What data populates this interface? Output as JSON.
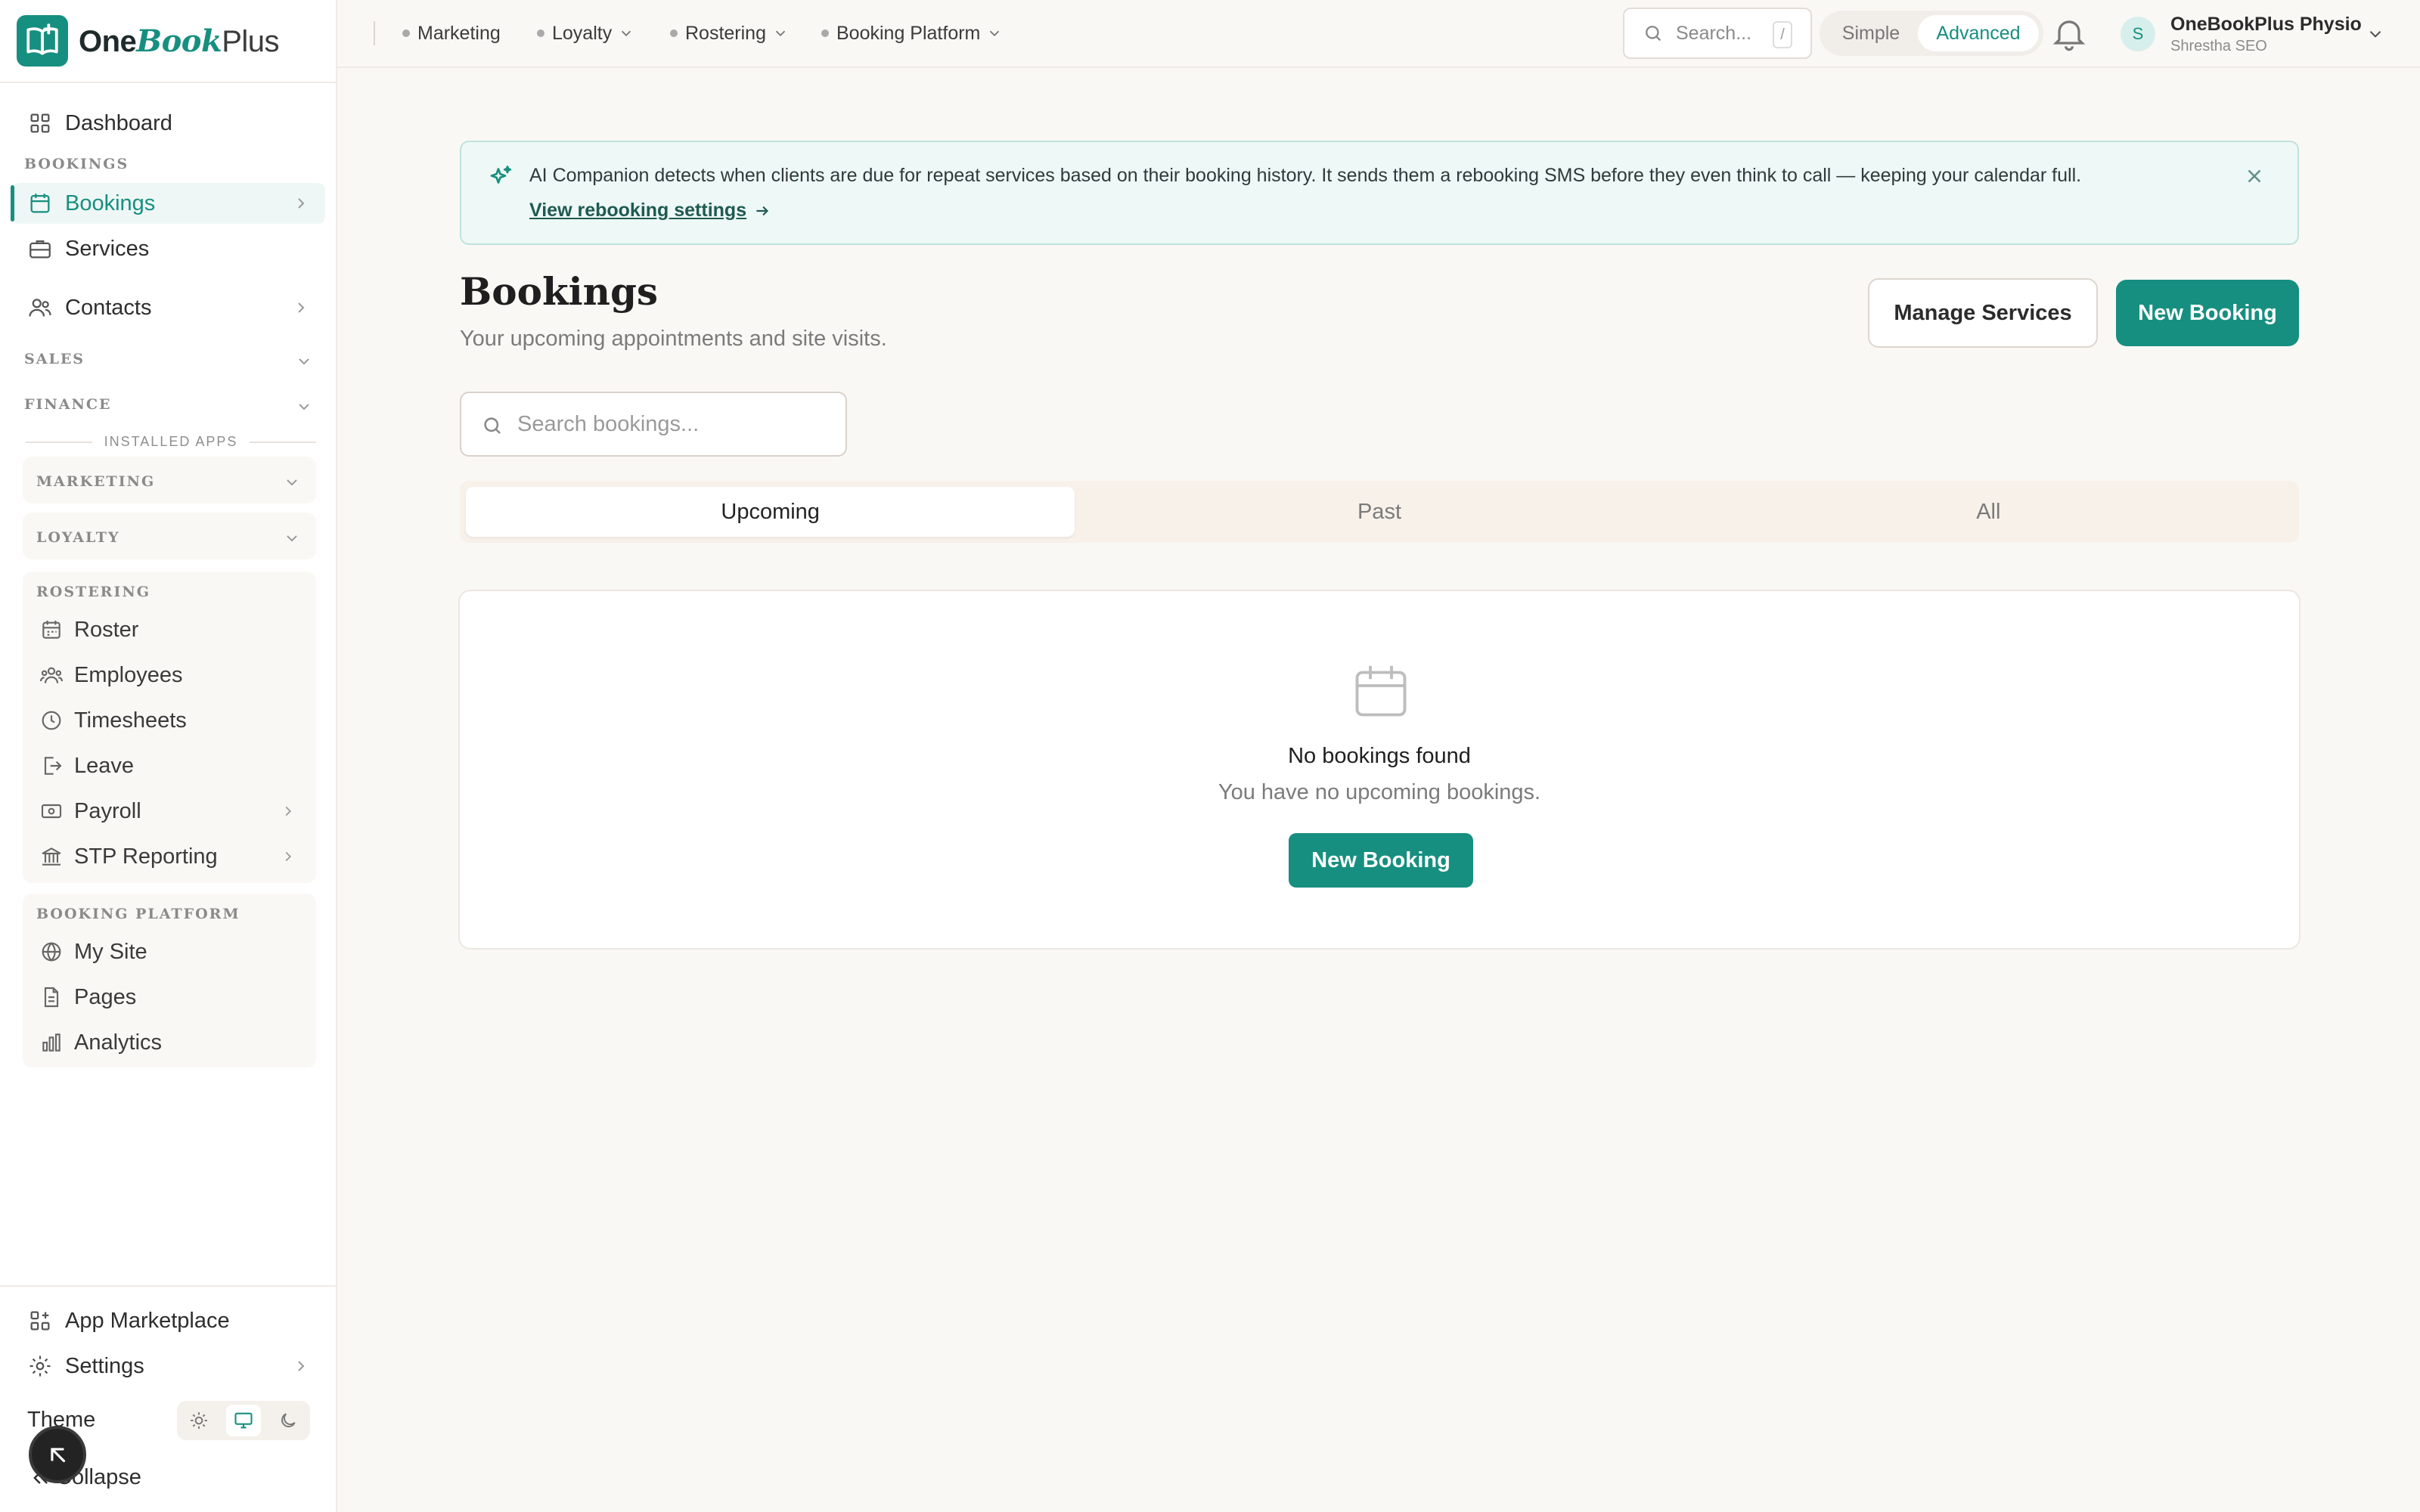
{
  "brand": {
    "part1": "One",
    "part2": "Book",
    "part3": "Plus"
  },
  "sidebar": {
    "dashboard": "Dashboard",
    "bookings_section": "BOOKINGS",
    "bookings": "Bookings",
    "services": "Services",
    "contacts": "Contacts",
    "sales_section": "SALES",
    "finance_section": "FINANCE",
    "installed_apps": "INSTALLED APPS",
    "marketing_section": "MARKETING",
    "loyalty_section": "LOYALTY",
    "rostering": {
      "label": "ROSTERING",
      "items": [
        "Roster",
        "Employees",
        "Timesheets",
        "Leave",
        "Payroll",
        "STP Reporting"
      ]
    },
    "booking_platform": {
      "label": "BOOKING PLATFORM",
      "items": [
        "My Site",
        "Pages",
        "Analytics"
      ]
    },
    "app_marketplace": "App Marketplace",
    "settings": "Settings",
    "theme": "Theme",
    "collapse": "Collapse"
  },
  "topbar": {
    "apps": [
      "Marketing",
      "Loyalty",
      "Rostering",
      "Booking Platform"
    ],
    "search_placeholder": "Search...",
    "search_shortcut": "/",
    "mode_simple": "Simple",
    "mode_advanced": "Advanced",
    "mode_selected": "Advanced",
    "avatar_initial": "S",
    "org_name": "OneBookPlus Physio",
    "user_name": "Shrestha SEO"
  },
  "banner": {
    "message": "AI Companion detects when clients are due for repeat services based on their booking history. It sends them a rebooking SMS before they even think to call — keeping your calendar full.",
    "link": "View rebooking settings"
  },
  "page": {
    "title": "Bookings",
    "subtitle": "Your upcoming appointments and site visits.",
    "manage_services": "Manage Services",
    "new_booking": "New Booking",
    "search_placeholder": "Search bookings...",
    "tabs": [
      "Upcoming",
      "Past",
      "All"
    ],
    "selected_tab": "Upcoming",
    "empty_title": "No bookings found",
    "empty_subtitle": "You have no upcoming bookings.",
    "empty_button": "New Booking"
  },
  "colors": {
    "accent": "#178f80",
    "background": "#faf8f5"
  }
}
